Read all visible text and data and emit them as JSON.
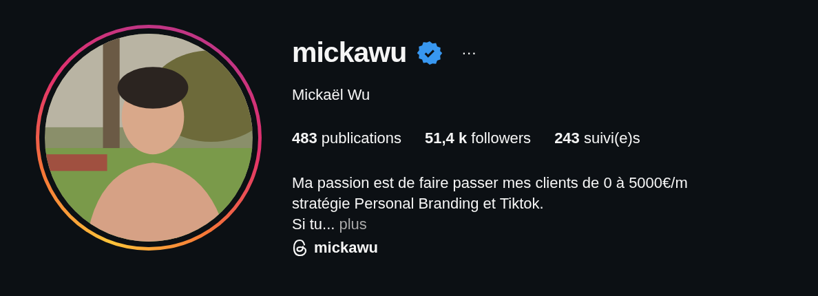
{
  "profile": {
    "username": "mickawu",
    "verified": true,
    "more": "···",
    "full_name": "Mickaël Wu",
    "stats": [
      "**483** publications",
      "**51,4 k** followers",
      "**243** suivi(e)s"
    ],
    "bio": [
      "Ma passion est de faire passer mes clients de 0 à 5000€/m",
      "stratégie Personal Branding et Tiktok.",
      "Si tu..."
    ],
    "bio_more": "plus",
    "threads_handle": "mickawu",
    "avatar": {
      "kind": "picture",
      "story_ring": true
    }
  }
}
